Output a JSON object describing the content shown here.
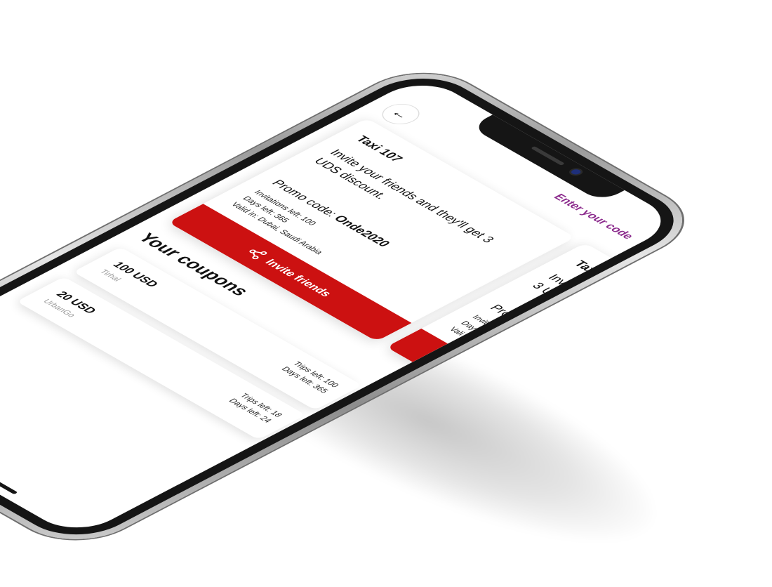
{
  "header": {
    "back_icon": "arrow-left-icon",
    "enter_code_link": "Enter your code"
  },
  "promo": {
    "title": "Taxi 107",
    "description": "Invite your friends and they'll get 3 UDS discount.",
    "code_label": "Promo code:",
    "code_value": "Onde2020",
    "invitations_left": "Invitations left: 100",
    "days_left": "Days left: 365",
    "valid_in": "Valid in: Dubai, Saudi Arabia",
    "invite_button": "Invite friends",
    "invite_icon": "share-icon",
    "brand_color": "#cc1111"
  },
  "next_promo": {
    "title": "Taxi",
    "description_start": "Invi",
    "description_line2": "3 U",
    "code_start": "Pro",
    "meta_1": "Invit",
    "meta_2": "Day",
    "meta_3": "Vali"
  },
  "coupons": {
    "section_title": "Your coupons",
    "items": [
      {
        "amount": "100 USD",
        "brand": "Tirhal",
        "trips_left": "Trips left: 100",
        "days_left": "Days left: 365"
      },
      {
        "amount": "20 USD",
        "brand": "UrbanGo",
        "trips_left": "Trips left: 18",
        "days_left": "Days left: 24"
      }
    ]
  },
  "colors": {
    "accent_link": "#8b2a8c",
    "button_red": "#cc1111"
  }
}
